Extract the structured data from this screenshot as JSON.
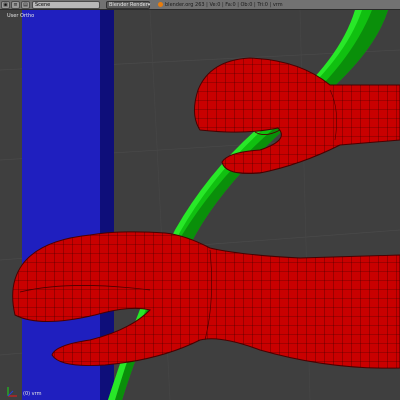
{
  "header": {
    "editor_icon": "view3d-icon",
    "menu_icon": "menu-icon",
    "screen_icon": "screen-layout-icon",
    "scene_field": "Scene",
    "renderer": "Blender Render",
    "stats": "blender.org 263 | Ve:0 | Fa:0 | Ob:0 | Tri:0 | vrm"
  },
  "viewport": {
    "view_name": "User Ortho",
    "object_label": "(0) vrm",
    "background_color": "#3f3f3f",
    "grid_color": "#4a4a4a"
  },
  "scene_objects": [
    {
      "name": "blue-bar",
      "color": "#1f1fbf"
    },
    {
      "name": "green-bar",
      "color": "#10c010"
    },
    {
      "name": "upper-hand",
      "color": "#c90000"
    },
    {
      "name": "lower-hand",
      "color": "#c90000"
    }
  ]
}
